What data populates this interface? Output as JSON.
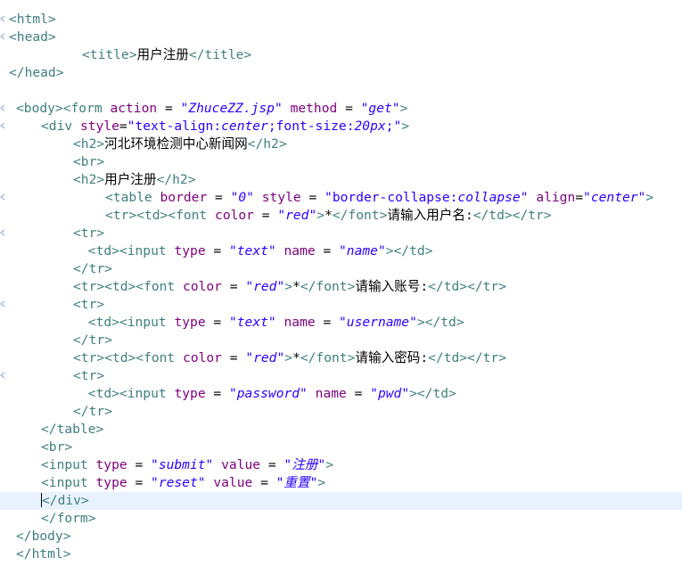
{
  "editor": {
    "lines": [
      {
        "fold": true,
        "tokens": [
          [
            "tag",
            "<html>"
          ]
        ]
      },
      {
        "fold": true,
        "tokens": [
          [
            "tag",
            "<head>"
          ]
        ]
      },
      {
        "fold": false,
        "tokens": [
          [
            "tag",
            "<title>"
          ],
          [
            "text",
            "用户注册"
          ],
          [
            "tag",
            "</title>"
          ]
        ]
      },
      {
        "fold": false,
        "tokens": [
          [
            "tag",
            "</head>"
          ]
        ]
      },
      {
        "fold": false,
        "tokens": []
      },
      {
        "fold": true,
        "tokens": [
          [
            "tag",
            "<body>"
          ],
          [
            "tag",
            "<form"
          ],
          [
            "text",
            " "
          ],
          [
            "attr",
            "action"
          ],
          [
            "text",
            " = "
          ],
          [
            "val",
            "\"ZhuceZZ.jsp\""
          ],
          [
            "text",
            " "
          ],
          [
            "attr",
            "method"
          ],
          [
            "text",
            " = "
          ],
          [
            "val",
            "\"get\""
          ],
          [
            "tag",
            ">"
          ]
        ]
      },
      {
        "fold": true,
        "tokens": [
          [
            "tag",
            "<div"
          ],
          [
            "text",
            " "
          ],
          [
            "attr",
            "style"
          ],
          [
            "text",
            "="
          ],
          [
            "valp",
            "\"text-align:"
          ],
          [
            "val",
            "center"
          ],
          [
            "valp",
            ";font-size:"
          ],
          [
            "val",
            "20px"
          ],
          [
            "valp",
            ";\""
          ],
          [
            "tag",
            ">"
          ]
        ]
      },
      {
        "fold": false,
        "tokens": [
          [
            "tag",
            "<h2>"
          ],
          [
            "text",
            "河北环境检测中心新闻网"
          ],
          [
            "tag",
            "</h2>"
          ]
        ]
      },
      {
        "fold": false,
        "tokens": [
          [
            "tag",
            "<br>"
          ]
        ]
      },
      {
        "fold": false,
        "tokens": [
          [
            "tag",
            "<h2>"
          ],
          [
            "text",
            "用户注册"
          ],
          [
            "tag",
            "</h2>"
          ]
        ]
      },
      {
        "fold": true,
        "tokens": [
          [
            "tag",
            "<table"
          ],
          [
            "text",
            " "
          ],
          [
            "attr",
            "border"
          ],
          [
            "text",
            " = "
          ],
          [
            "val",
            "\"0\""
          ],
          [
            "text",
            " "
          ],
          [
            "attr",
            "style"
          ],
          [
            "text",
            " = "
          ],
          [
            "valp",
            "\"border-collapse:"
          ],
          [
            "val",
            "collapse"
          ],
          [
            "valp",
            "\""
          ],
          [
            "text",
            " "
          ],
          [
            "attr",
            "align"
          ],
          [
            "text",
            "="
          ],
          [
            "val",
            "\"center\""
          ],
          [
            "tag",
            ">"
          ]
        ]
      },
      {
        "fold": false,
        "tokens": [
          [
            "tag",
            "<tr><td><font"
          ],
          [
            "text",
            " "
          ],
          [
            "attr",
            "color"
          ],
          [
            "text",
            " = "
          ],
          [
            "val",
            "\"red\""
          ],
          [
            "tag",
            ">"
          ],
          [
            "text",
            "*"
          ],
          [
            "tag",
            "</font>"
          ],
          [
            "text",
            "请输入用户名:"
          ],
          [
            "tag",
            "</td></tr>"
          ]
        ]
      },
      {
        "fold": true,
        "tokens": [
          [
            "tag",
            "<tr>"
          ]
        ]
      },
      {
        "fold": false,
        "tokens": [
          [
            "text",
            " "
          ],
          [
            "tag",
            "<td><input"
          ],
          [
            "text",
            " "
          ],
          [
            "attr",
            "type"
          ],
          [
            "text",
            " = "
          ],
          [
            "val",
            "\"text\""
          ],
          [
            "text",
            " "
          ],
          [
            "attr",
            "name"
          ],
          [
            "text",
            " = "
          ],
          [
            "val",
            "\"name\""
          ],
          [
            "tag",
            "></td>"
          ]
        ]
      },
      {
        "fold": false,
        "tokens": [
          [
            "tag",
            "</tr>"
          ]
        ]
      },
      {
        "fold": false,
        "tokens": [
          [
            "tag",
            "<tr><td><font"
          ],
          [
            "text",
            " "
          ],
          [
            "attr",
            "color"
          ],
          [
            "text",
            " = "
          ],
          [
            "val",
            "\"red\""
          ],
          [
            "tag",
            ">"
          ],
          [
            "text",
            "*"
          ],
          [
            "tag",
            "</font>"
          ],
          [
            "text",
            "请输入账号:"
          ],
          [
            "tag",
            "</td></tr>"
          ]
        ]
      },
      {
        "fold": true,
        "tokens": [
          [
            "tag",
            "<tr>"
          ]
        ]
      },
      {
        "fold": false,
        "tokens": [
          [
            "text",
            " "
          ],
          [
            "tag",
            "<td><input"
          ],
          [
            "text",
            " "
          ],
          [
            "attr",
            "type"
          ],
          [
            "text",
            " = "
          ],
          [
            "val",
            "\"text\""
          ],
          [
            "text",
            " "
          ],
          [
            "attr",
            "name"
          ],
          [
            "text",
            " = "
          ],
          [
            "val",
            "\"username\""
          ],
          [
            "tag",
            "></td>"
          ]
        ]
      },
      {
        "fold": false,
        "tokens": [
          [
            "tag",
            "</tr>"
          ]
        ]
      },
      {
        "fold": false,
        "tokens": [
          [
            "tag",
            "<tr><td><font"
          ],
          [
            "text",
            " "
          ],
          [
            "attr",
            "color"
          ],
          [
            "text",
            " = "
          ],
          [
            "val",
            "\"red\""
          ],
          [
            "tag",
            ">"
          ],
          [
            "text",
            "*"
          ],
          [
            "tag",
            "</font>"
          ],
          [
            "text",
            "请输入密码:"
          ],
          [
            "tag",
            "</td></tr>"
          ]
        ]
      },
      {
        "fold": true,
        "tokens": [
          [
            "tag",
            "<tr>"
          ]
        ]
      },
      {
        "fold": false,
        "tokens": [
          [
            "text",
            " "
          ],
          [
            "tag",
            "<td><input"
          ],
          [
            "text",
            " "
          ],
          [
            "attr",
            "type"
          ],
          [
            "text",
            " = "
          ],
          [
            "val",
            "\"password\""
          ],
          [
            "text",
            " "
          ],
          [
            "attr",
            "name"
          ],
          [
            "text",
            " = "
          ],
          [
            "val",
            "\"pwd\""
          ],
          [
            "tag",
            "></td>"
          ]
        ]
      },
      {
        "fold": false,
        "tokens": [
          [
            "tag",
            "</tr>"
          ]
        ]
      },
      {
        "fold": false,
        "tokens": [
          [
            "tag",
            "</table>"
          ]
        ]
      },
      {
        "fold": false,
        "tokens": [
          [
            "tag",
            "<br>"
          ]
        ]
      },
      {
        "fold": false,
        "tokens": [
          [
            "tag",
            "<input"
          ],
          [
            "text",
            " "
          ],
          [
            "attr",
            "type"
          ],
          [
            "text",
            " = "
          ],
          [
            "val",
            "\"submit\""
          ],
          [
            "text",
            " "
          ],
          [
            "attr",
            "value"
          ],
          [
            "text",
            " = "
          ],
          [
            "val",
            "\"注册\""
          ],
          [
            "tag",
            ">"
          ]
        ]
      },
      {
        "fold": false,
        "tokens": [
          [
            "tag",
            "<input"
          ],
          [
            "text",
            " "
          ],
          [
            "attr",
            "type"
          ],
          [
            "text",
            " = "
          ],
          [
            "val",
            "\"reset\""
          ],
          [
            "text",
            " "
          ],
          [
            "attr",
            "value"
          ],
          [
            "text",
            " = "
          ],
          [
            "val",
            "\"重置\""
          ],
          [
            "tag",
            ">"
          ]
        ]
      },
      {
        "fold": false,
        "current": true,
        "tokens": [
          [
            "caret",
            ""
          ],
          [
            "tag",
            "</div>"
          ]
        ]
      },
      {
        "fold": false,
        "tokens": [
          [
            "tag",
            "</form>"
          ]
        ]
      },
      {
        "fold": false,
        "tokens": [
          [
            "tag",
            "</body>"
          ]
        ]
      },
      {
        "fold": false,
        "tokens": [
          [
            "tag",
            "</html>"
          ]
        ]
      }
    ]
  },
  "colors": {
    "tag": "#3f7f7f",
    "attr": "#7f007f",
    "value": "#2a00ff",
    "text": "#000000",
    "current_line": "#e8f2fe",
    "fold_marker": "#8aa7c9"
  }
}
